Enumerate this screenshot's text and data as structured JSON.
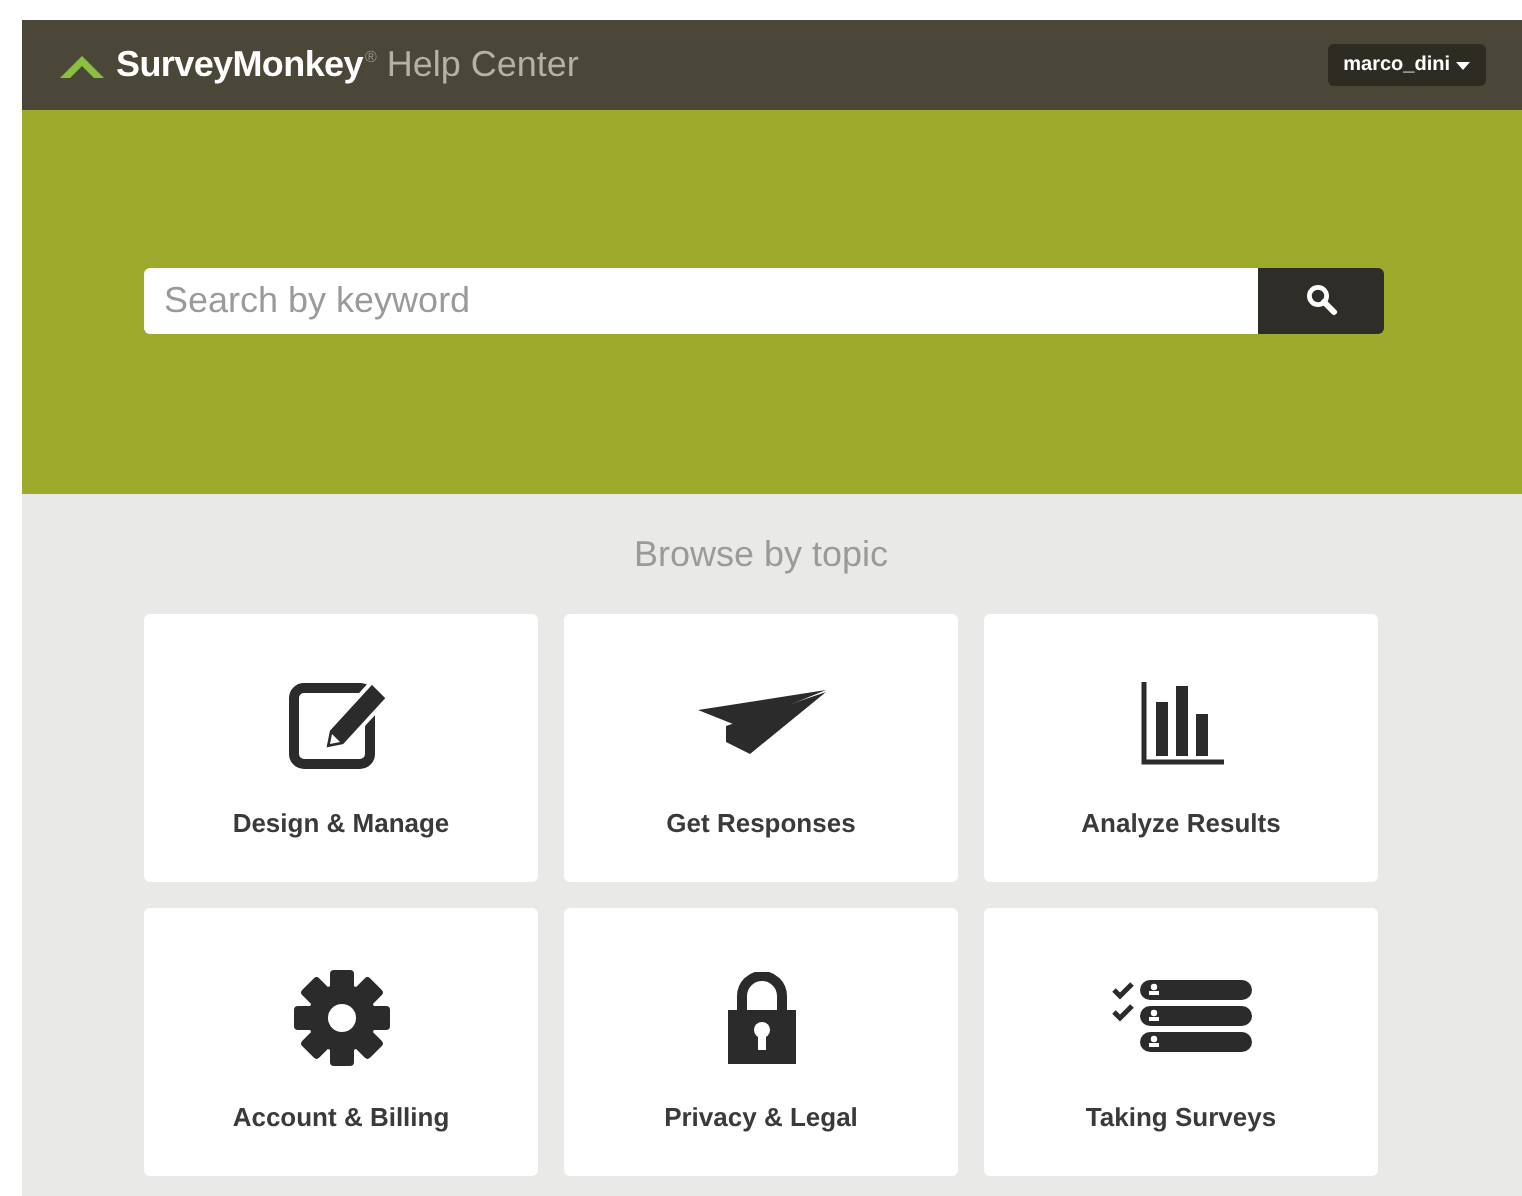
{
  "header": {
    "brand": "SurveyMonkey",
    "brand_mark": "®",
    "section": "Help Center",
    "user_menu": "marco_dini"
  },
  "search": {
    "placeholder": "Search by keyword"
  },
  "browse": {
    "title": "Browse by topic",
    "topics": [
      {
        "label": "Design & Manage",
        "kind": "edit"
      },
      {
        "label": "Get Responses",
        "kind": "plane"
      },
      {
        "label": "Analyze Results",
        "kind": "chart"
      },
      {
        "label": "Account & Billing",
        "kind": "gear"
      },
      {
        "label": "Privacy & Legal",
        "kind": "lock"
      },
      {
        "label": "Taking Surveys",
        "kind": "list"
      }
    ]
  }
}
